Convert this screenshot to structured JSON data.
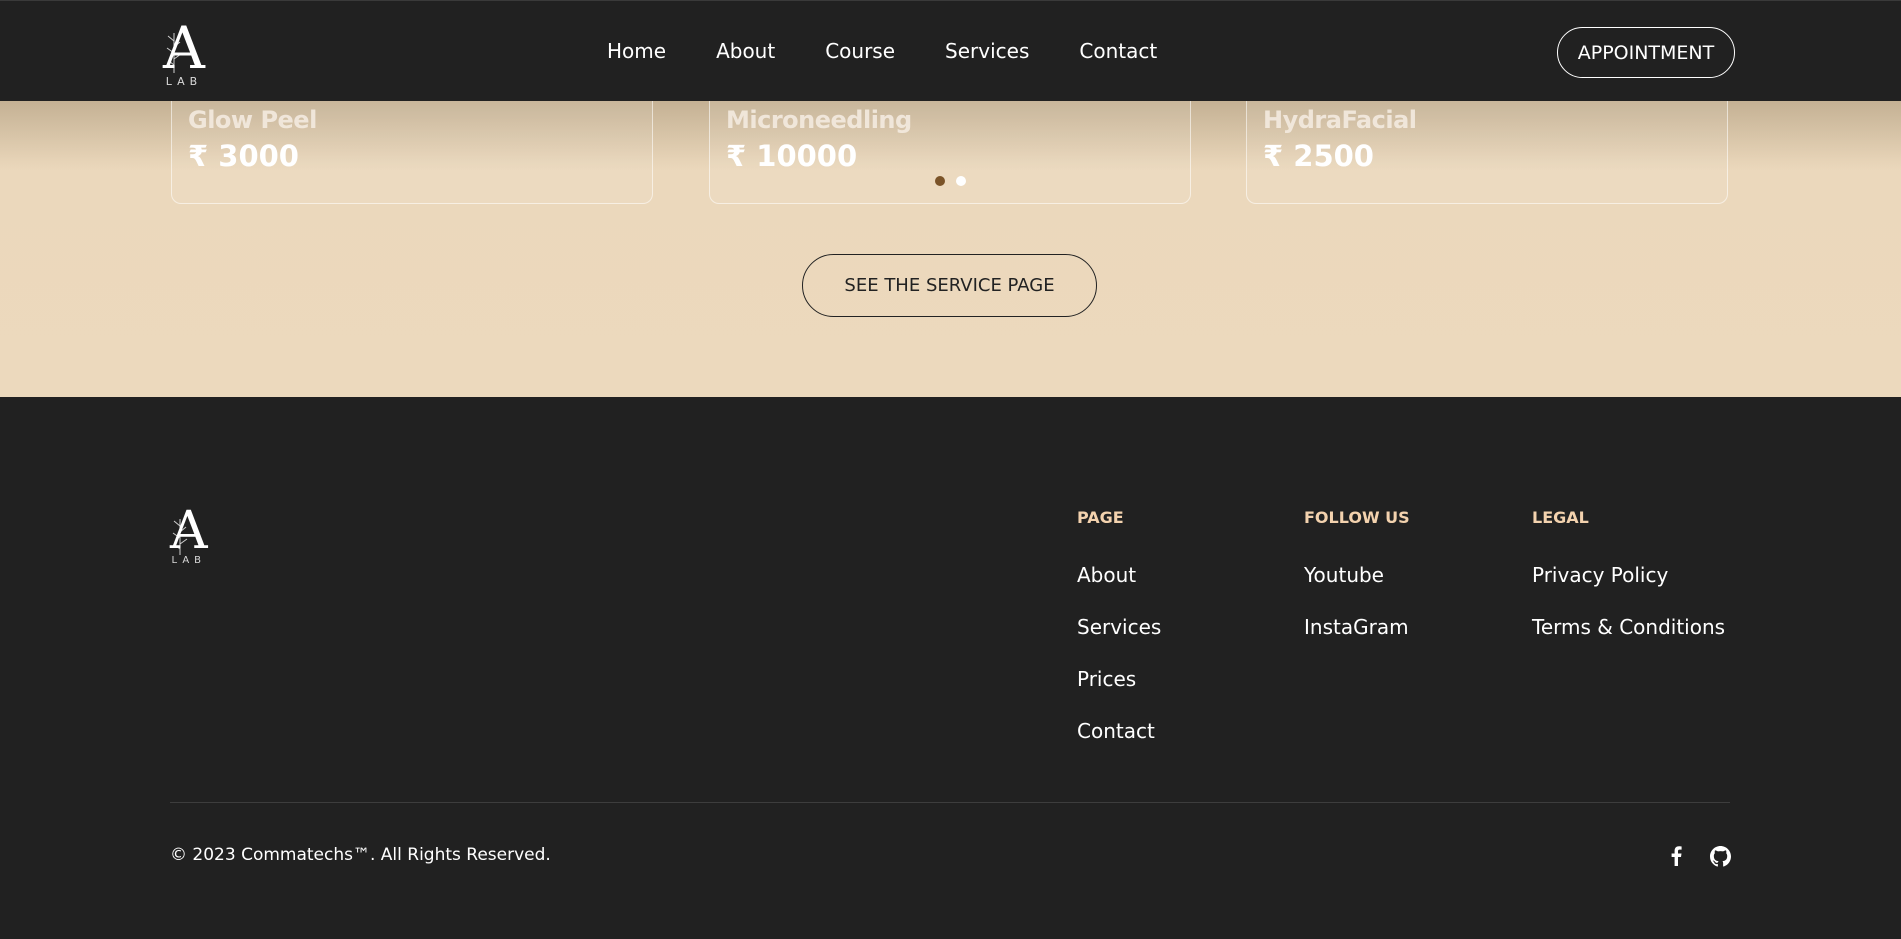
{
  "brand": {
    "logo_letter": "A",
    "logo_sub": "LAB"
  },
  "nav": {
    "items": [
      "Home",
      "About",
      "Course",
      "Services",
      "Contact"
    ],
    "appointment_label": "APPOINTMENT"
  },
  "services": {
    "cards": [
      {
        "name": "Glow Peel",
        "price": "₹ 3000"
      },
      {
        "name": "Microneedling",
        "price": "₹ 10000"
      },
      {
        "name": "HydraFacial",
        "price": "₹ 2500"
      }
    ],
    "carousel": {
      "pages": 2,
      "active_index": 0
    },
    "see_all_label": "SEE THE SERVICE PAGE"
  },
  "footer": {
    "columns": [
      {
        "heading": "PAGE",
        "links": [
          "About",
          "Services",
          "Prices",
          "Contact"
        ]
      },
      {
        "heading": "FOLLOW US",
        "links": [
          "Youtube",
          "InstaGram"
        ]
      },
      {
        "heading": "LEGAL",
        "links": [
          "Privacy Policy",
          "Terms & Conditions"
        ]
      }
    ],
    "copyright": "© 2023 Commatechs™. All Rights Reserved.",
    "social_icons": [
      "facebook-icon",
      "github-icon"
    ]
  },
  "colors": {
    "dark_bg": "#212121",
    "beige_bg": "#ecd9bd",
    "accent_heading": "#f3d2ae",
    "dot_active": "#7a5328"
  }
}
